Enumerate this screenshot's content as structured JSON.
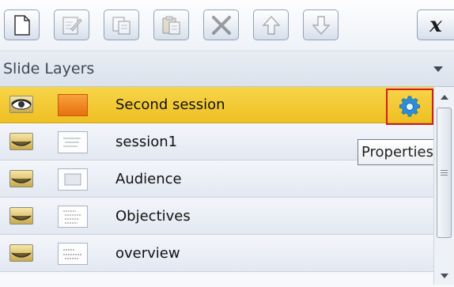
{
  "toolbar": {
    "buttons": [
      {
        "name": "new-layer-button",
        "icon": "new-page-icon",
        "enabled": true
      },
      {
        "name": "edit-layer-button",
        "icon": "edit-icon",
        "enabled": false
      },
      {
        "name": "copy-layer-button",
        "icon": "copy-icon",
        "enabled": false
      },
      {
        "name": "paste-layer-button",
        "icon": "paste-icon",
        "enabled": false
      },
      {
        "name": "delete-layer-button",
        "icon": "delete-x-icon",
        "enabled": false
      },
      {
        "name": "move-up-button",
        "icon": "arrow-up-icon",
        "enabled": false
      },
      {
        "name": "move-down-button",
        "icon": "arrow-down-icon",
        "enabled": false
      }
    ],
    "close_label": "x"
  },
  "panel": {
    "title": "Slide Layers"
  },
  "layers": [
    {
      "label": "Second session",
      "selected": true
    },
    {
      "label": "session1",
      "selected": false
    },
    {
      "label": "Audience",
      "selected": false
    },
    {
      "label": "Objectives",
      "selected": false
    },
    {
      "label": "overview",
      "selected": false
    }
  ],
  "properties": {
    "icon": "gear-icon",
    "tooltip": "Properties"
  },
  "colors": {
    "selected_row": "#f2c62c",
    "highlight_border": "#d11e1e",
    "gear": "#2a8fd8"
  }
}
